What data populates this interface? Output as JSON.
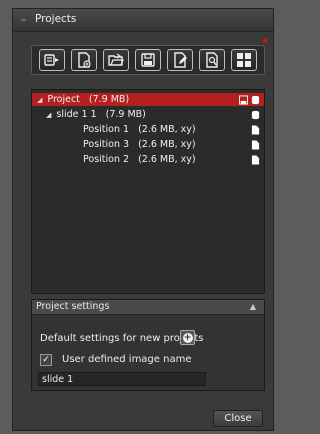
{
  "window": {
    "title": "Projects"
  },
  "toolbar": {
    "buttons": [
      "new-project-icon",
      "new-file-icon",
      "open-folder-icon",
      "save-icon",
      "edit-file-icon",
      "search-icon",
      "grid-icon"
    ]
  },
  "tree": {
    "project": {
      "label": "Project",
      "meta": "(7.9 MB)"
    },
    "slide": {
      "label": "slide 1 1",
      "meta": "(7.9 MB)"
    },
    "positions": [
      {
        "label": "Position 1",
        "meta": "(2.6 MB, xy)"
      },
      {
        "label": "Position 3",
        "meta": "(2.6 MB, xy)"
      },
      {
        "label": "Position 2",
        "meta": "(2.6 MB, xy)"
      }
    ]
  },
  "settings": {
    "header": "Project settings",
    "default_label": "Default settings for new projects",
    "checkbox_label": "User defined image name",
    "checkbox_checked": true,
    "name_value": "slide 1"
  },
  "footer": {
    "close_label": "Close"
  }
}
